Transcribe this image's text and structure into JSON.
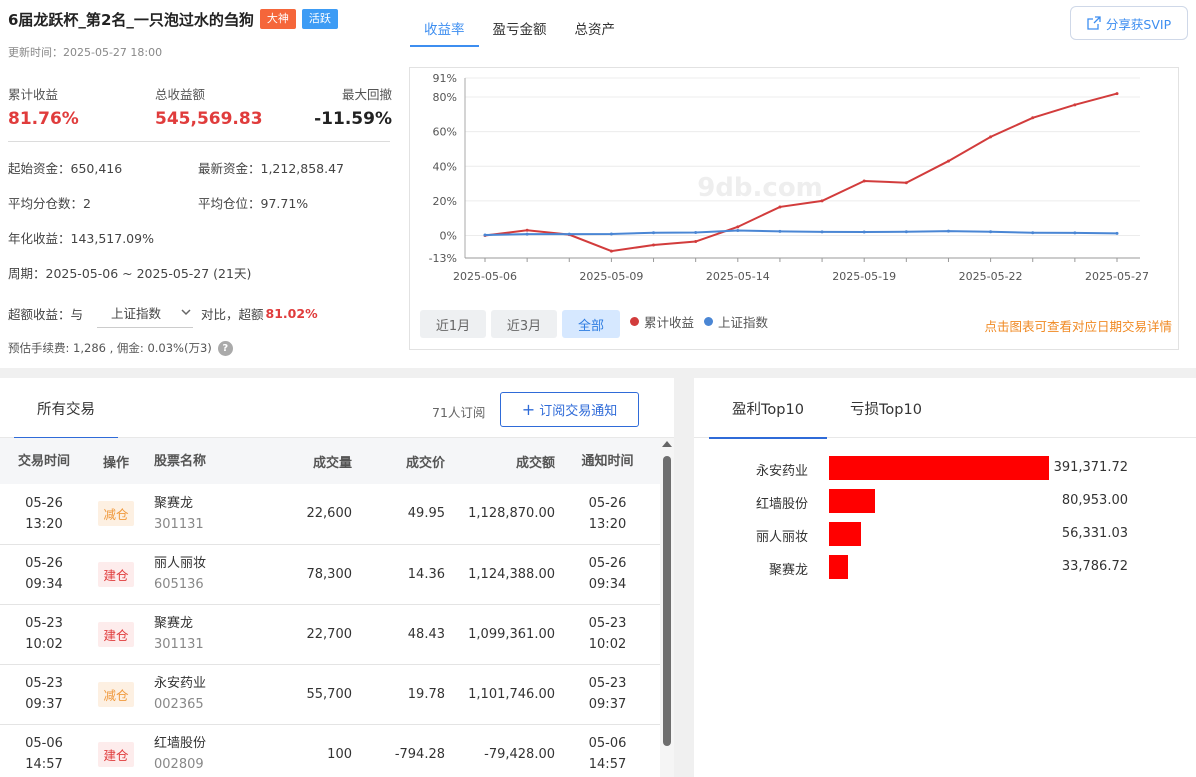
{
  "summary": {
    "title": "6届龙跃杯_第2名_一只泡过水的刍狗",
    "badge1": "大神",
    "badge2": "活跃",
    "update": "更新时间：2025-05-27 18:00",
    "kpi1_label": "累计收益",
    "kpi1_value": "81.76%",
    "kpi2_label": "总收益额",
    "kpi2_value": "545,569.83",
    "kpi3_label": "最大回撤",
    "kpi3_value": "-11.59%",
    "start_capital": "起始资金：650,416",
    "latest_capital": "最新资金：1,212,858.47",
    "avg_split": "平均分仓数：2",
    "avg_position": "平均仓位：97.71%",
    "annual": "年化收益：143,517.09%",
    "period": "周期：2025-05-06 ~ 2025-05-27 (21天)",
    "excess_label": "超额收益：与",
    "benchmark": "上证指数",
    "excess_mid": "对比，超额",
    "excess_value": "81.02%",
    "fee": "预估手续费: 1,286 , 佣金: 0.03%(万3)",
    "help_icon": "question-icon"
  },
  "chart_tabs": [
    "收益率",
    "盈亏金额",
    "总资产"
  ],
  "share_label": "分享获SVIP",
  "range_buttons": [
    "近1月",
    "近3月",
    "全部"
  ],
  "legend": [
    "累计收益",
    "上证指数"
  ],
  "hint": "点击图表可查看对应日期交易详情",
  "watermark": "9db.com",
  "colors": {
    "cumulative": "#d23c3c",
    "index": "#4a86d4",
    "accent": "#3d8ef0"
  },
  "chart_data": {
    "type": "line",
    "x_ticks": [
      "2025-05-06",
      "2025-05-09",
      "2025-05-14",
      "2025-05-19",
      "2025-05-22",
      "2025-05-27"
    ],
    "y_ticks": [
      "91%",
      "80%",
      "60%",
      "40%",
      "20%",
      "0%",
      "-13%"
    ],
    "ylim": [
      -13,
      91
    ],
    "series": [
      {
        "name": "累计收益",
        "values": [
          0,
          3,
          0.5,
          -9,
          -5.5,
          -3.5,
          5,
          16.5,
          20,
          31.5,
          30.5,
          43,
          57,
          68,
          75.5,
          82
        ]
      },
      {
        "name": "上证指数",
        "values": [
          0.3,
          0.8,
          0.8,
          0.9,
          1.6,
          1.7,
          2.9,
          2.4,
          2.1,
          2.0,
          2.2,
          2.5,
          2.2,
          1.6,
          1.5,
          1.2
        ]
      }
    ]
  },
  "trades": {
    "tab": "所有交易",
    "subscribers": "71人订阅",
    "subscribe_button": "订阅交易通知",
    "headers": [
      "交易时间",
      "操作",
      "股票名称",
      "成交量",
      "成交价",
      "成交额",
      "通知时间"
    ],
    "rows": [
      {
        "date": "05-26",
        "time": "13:20",
        "op": "减仓",
        "kind": "reduce",
        "name": "聚赛龙",
        "code": "301131",
        "vol": "22,600",
        "price": "49.95",
        "amount": "1,128,870.00",
        "n_date": "05-26",
        "n_time": "13:20"
      },
      {
        "date": "05-26",
        "time": "09:34",
        "op": "建仓",
        "kind": "build",
        "name": "丽人丽妆",
        "code": "605136",
        "vol": "78,300",
        "price": "14.36",
        "amount": "1,124,388.00",
        "n_date": "05-26",
        "n_time": "09:34"
      },
      {
        "date": "05-23",
        "time": "10:02",
        "op": "建仓",
        "kind": "build",
        "name": "聚赛龙",
        "code": "301131",
        "vol": "22,700",
        "price": "48.43",
        "amount": "1,099,361.00",
        "n_date": "05-23",
        "n_time": "10:02"
      },
      {
        "date": "05-23",
        "time": "09:37",
        "op": "减仓",
        "kind": "reduce",
        "name": "永安药业",
        "code": "002365",
        "vol": "55,700",
        "price": "19.78",
        "amount": "1,101,746.00",
        "n_date": "05-23",
        "n_time": "09:37"
      },
      {
        "date": "05-06",
        "time": "14:57",
        "op": "建仓",
        "kind": "build",
        "name": "红墙股份",
        "code": "002809",
        "vol": "100",
        "price": "-794.28",
        "amount": "-79,428.00",
        "n_date": "05-06",
        "n_time": "14:57"
      }
    ]
  },
  "top10": {
    "tab_profit": "盈利Top10",
    "tab_loss": "亏损Top10",
    "items": [
      {
        "name": "永安药业",
        "value": "391,371.72",
        "amount": 391371.72
      },
      {
        "name": "红墙股份",
        "value": "80,953.00",
        "amount": 80953.0
      },
      {
        "name": "丽人丽妆",
        "value": "56,331.03",
        "amount": 56331.03
      },
      {
        "name": "聚赛龙",
        "value": "33,786.72",
        "amount": 33786.72
      }
    ]
  }
}
